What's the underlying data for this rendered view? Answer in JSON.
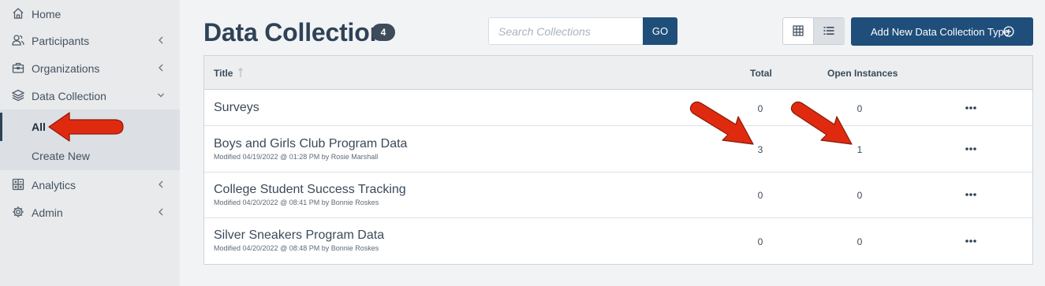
{
  "sidebar": {
    "items": [
      {
        "label": "Home",
        "icon": "home-icon",
        "has_chevron": false
      },
      {
        "label": "Participants",
        "icon": "users-icon",
        "has_chevron": true
      },
      {
        "label": "Organizations",
        "icon": "briefcase-icon",
        "has_chevron": true
      },
      {
        "label": "Data Collection",
        "icon": "layers-icon",
        "has_chevron": true,
        "expanded": true
      },
      {
        "label": "Analytics",
        "icon": "calculator-icon",
        "has_chevron": true
      },
      {
        "label": "Admin",
        "icon": "gear-icon",
        "has_chevron": true
      }
    ],
    "sub_items": [
      {
        "label": "All",
        "active": true
      },
      {
        "label": "Create New",
        "active": false
      }
    ]
  },
  "header": {
    "title": "Data Collection",
    "count": "4",
    "search_placeholder": "Search Collections",
    "go_label": "GO",
    "view_mode": "list",
    "add_button_label": "Add New Data Collection Type"
  },
  "table": {
    "columns": {
      "title": "Title",
      "total": "Total",
      "open": "Open Instances"
    },
    "sort_icon": "sort-up-arrow-icon",
    "rows": [
      {
        "title": "Surveys",
        "meta": "",
        "total": "0",
        "open": "0"
      },
      {
        "title": "Boys and Girls Club Program Data",
        "meta": "Modified 04/19/2022 @ 01:28 PM by Rosie Marshall",
        "total": "3",
        "open": "1"
      },
      {
        "title": "College Student Success Tracking",
        "meta": "Modified 04/20/2022 @ 08:41 PM by Bonnie Roskes",
        "total": "0",
        "open": "0"
      },
      {
        "title": "Silver Sneakers Program Data",
        "meta": "Modified 04/20/2022 @ 08:48 PM by Bonnie Roskes",
        "total": "0",
        "open": "0"
      }
    ]
  },
  "colors": {
    "primary": "#1f4e7a",
    "title": "#2f4257",
    "sidebar_bg": "#e8eaec",
    "annotation_arrow": "#e02a10"
  }
}
